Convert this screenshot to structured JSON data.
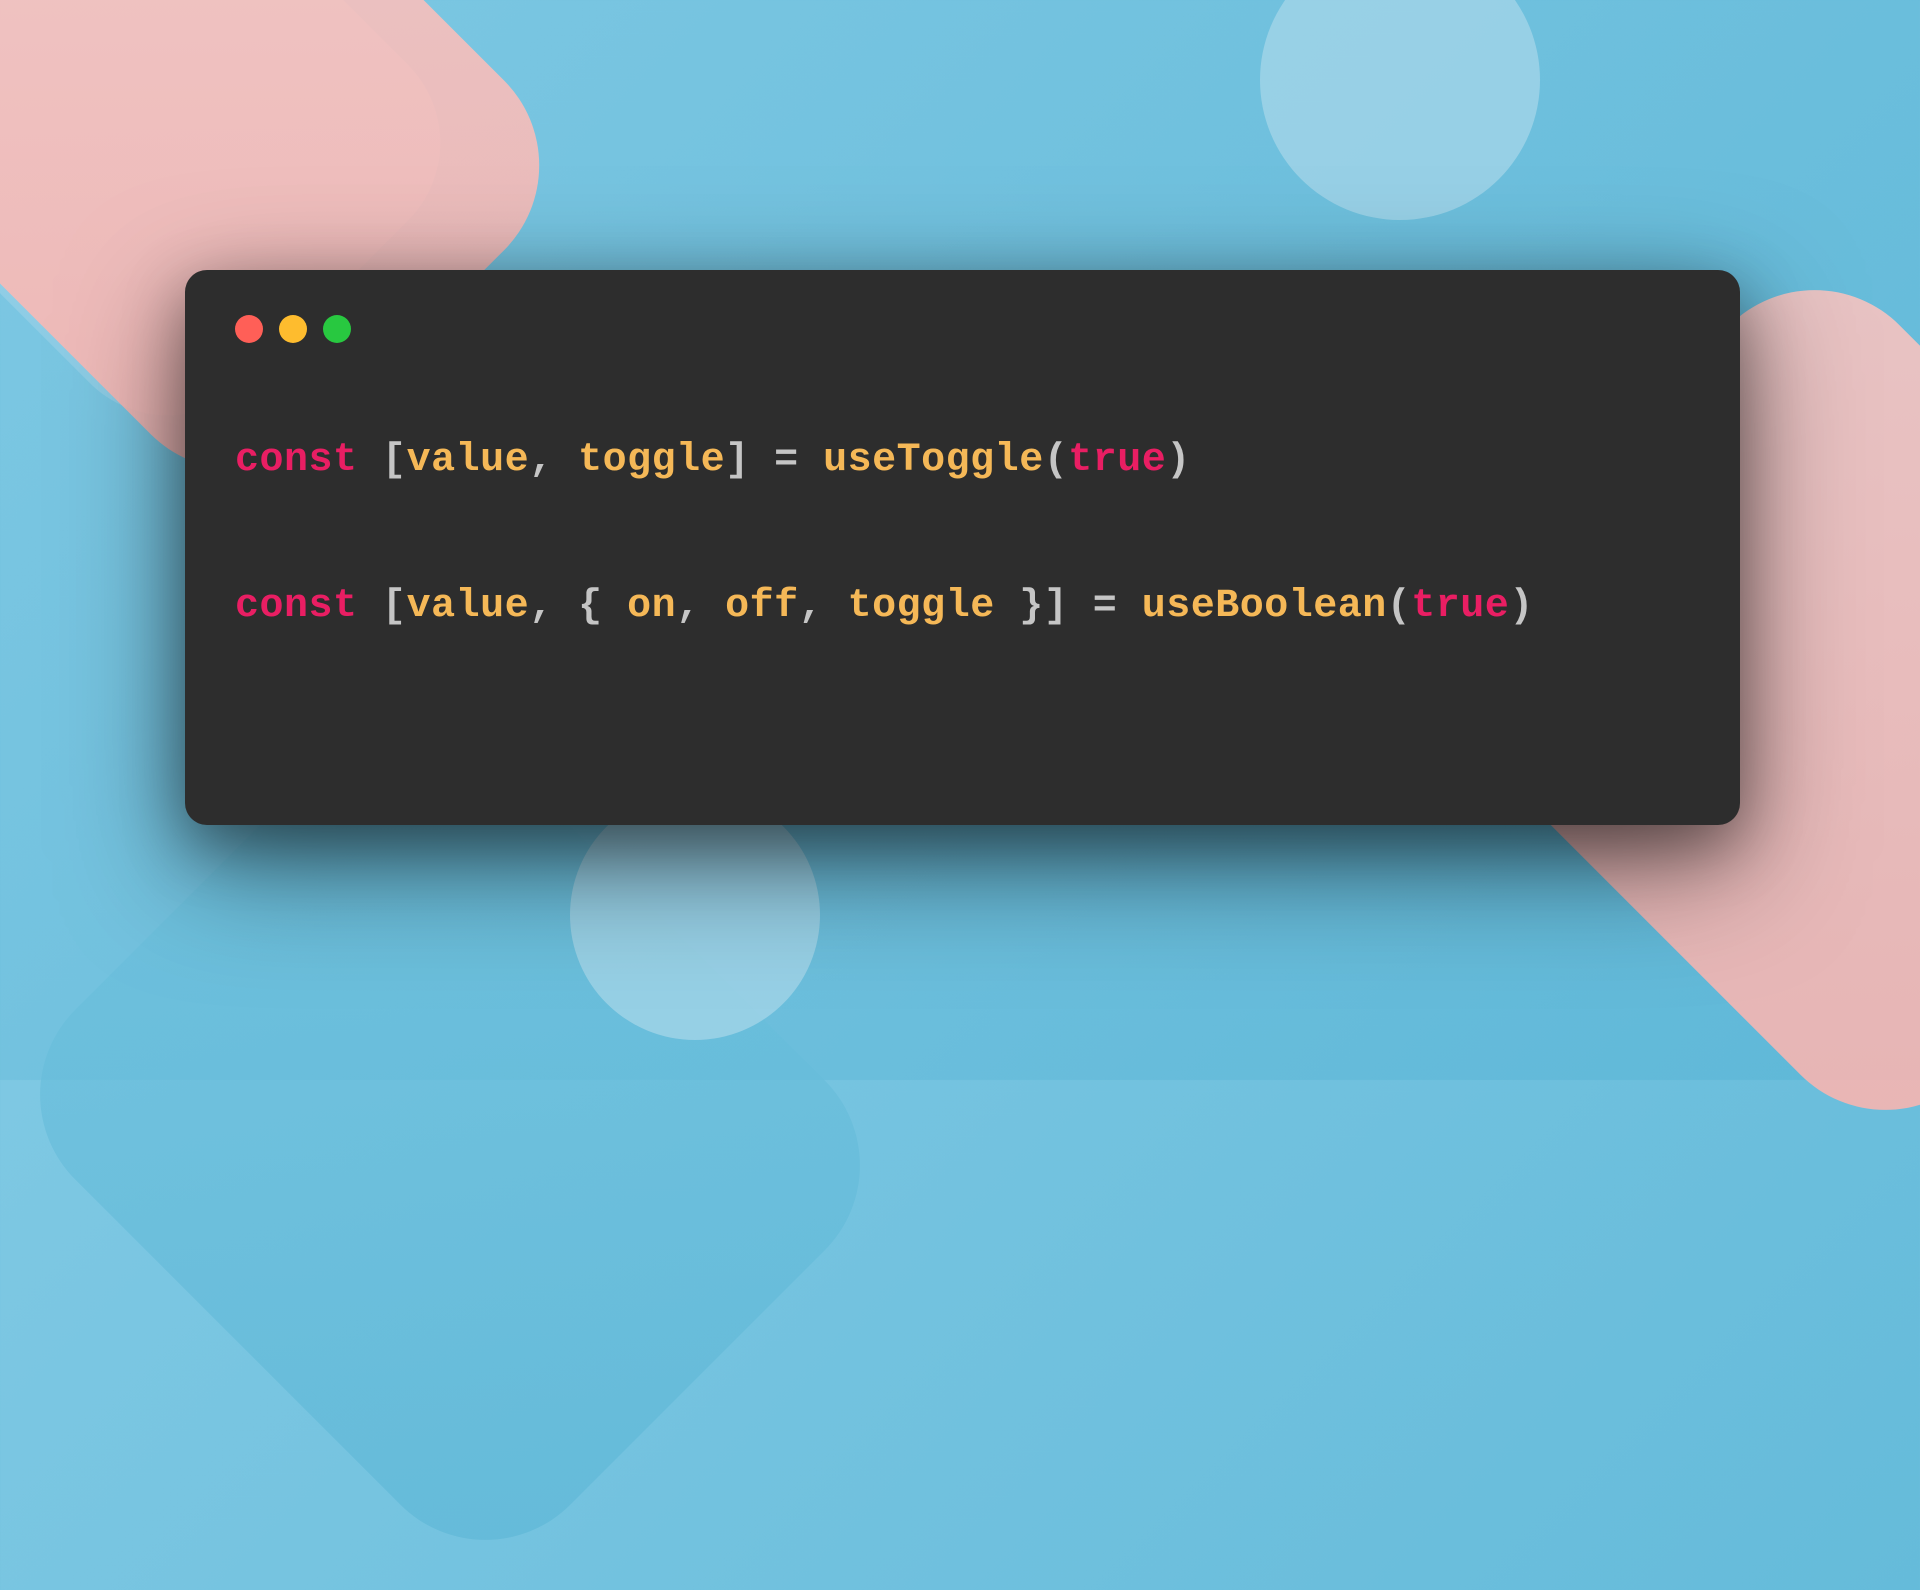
{
  "background": {
    "shapes": [
      "pink-rounded-1",
      "pink-rounded-2",
      "blue-rounded-1",
      "blue-rounded-2",
      "circle-1",
      "circle-2"
    ]
  },
  "editor": {
    "window_controls": {
      "red": "#ff5f57",
      "yellow": "#febc2e",
      "green": "#28c840"
    },
    "lines": [
      {
        "tokens": [
          {
            "type": "keyword",
            "text": "const"
          },
          {
            "type": "space",
            "text": " "
          },
          {
            "type": "punct",
            "text": "["
          },
          {
            "type": "var",
            "text": "value"
          },
          {
            "type": "punct",
            "text": ", "
          },
          {
            "type": "var",
            "text": "toggle"
          },
          {
            "type": "punct",
            "text": "] = "
          },
          {
            "type": "func",
            "text": "useToggle"
          },
          {
            "type": "punct",
            "text": "("
          },
          {
            "type": "bool",
            "text": "true"
          },
          {
            "type": "punct",
            "text": ")"
          }
        ]
      },
      {
        "tokens": [
          {
            "type": "keyword",
            "text": "const"
          },
          {
            "type": "space",
            "text": " "
          },
          {
            "type": "punct",
            "text": "["
          },
          {
            "type": "var",
            "text": "value"
          },
          {
            "type": "punct",
            "text": ", { "
          },
          {
            "type": "var",
            "text": "on"
          },
          {
            "type": "punct",
            "text": ", "
          },
          {
            "type": "var",
            "text": "off"
          },
          {
            "type": "punct",
            "text": ", "
          },
          {
            "type": "var",
            "text": "toggle"
          },
          {
            "type": "punct",
            "text": " }] = "
          },
          {
            "type": "func",
            "text": "useBoolean"
          },
          {
            "type": "punct",
            "text": "("
          },
          {
            "type": "bool",
            "text": "true"
          },
          {
            "type": "punct",
            "text": ")"
          }
        ]
      }
    ]
  },
  "colors": {
    "editor_bg": "#2d2d2d",
    "keyword": "#e91e63",
    "punctuation": "#c5c5c5",
    "variable": "#f5b857",
    "function": "#f5b857",
    "boolean": "#e91e63"
  }
}
